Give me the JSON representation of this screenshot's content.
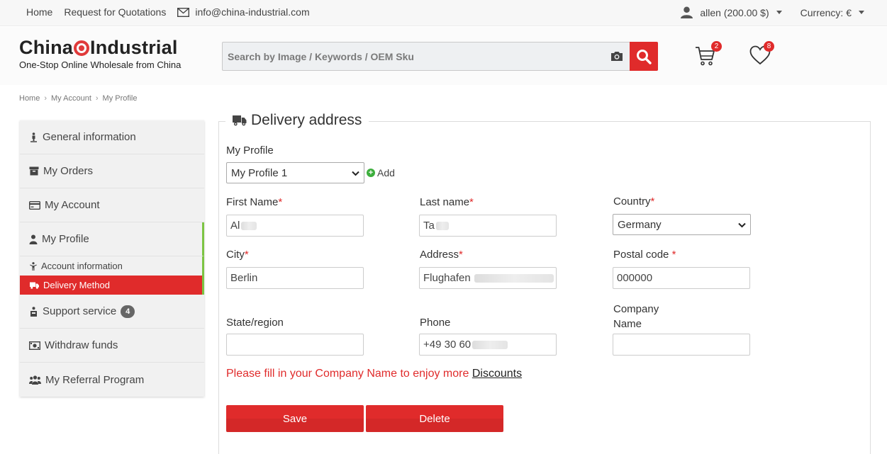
{
  "topbar": {
    "home": "Home",
    "quotations": "Request for Quotations",
    "email": "info@china-industrial.com",
    "user": "allen (200.00 $)",
    "currency": "Currency: €"
  },
  "header": {
    "logo_left": "China",
    "logo_right": "Industrial",
    "tagline": "One-Stop Online Wholesale from China",
    "search_placeholder": "Search by Image / Keywords / OEM Sku",
    "cart_count": "2",
    "wishlist_count": "8"
  },
  "breadcrumb": [
    "Home",
    "My Account",
    "My Profile"
  ],
  "sidebar": {
    "items": [
      {
        "label": "General information"
      },
      {
        "label": "My Orders"
      },
      {
        "label": "My Account"
      },
      {
        "label": "My Profile"
      }
    ],
    "sub_items": [
      {
        "label": "Account information"
      },
      {
        "label": "Delivery Method"
      }
    ],
    "items_after": [
      {
        "label": "Support service",
        "badge": "4"
      },
      {
        "label": "Withdraw funds"
      },
      {
        "label": "My Referral Program"
      }
    ]
  },
  "form": {
    "legend": "Delivery address",
    "profile_label": "My Profile",
    "profile_value": "My Profile 1",
    "add_label": "Add",
    "required_mark": "*",
    "first_name_label": "First Name",
    "first_name_value": "Al",
    "last_name_label": "Last name",
    "last_name_value": "Ta",
    "country_label": "Country",
    "country_value": "Germany",
    "city_label": "City",
    "city_value": "Berlin",
    "address_label": "Address",
    "address_value": "Flughafen",
    "postal_label": "Postal code",
    "postal_value": "000000",
    "state_label": "State/region",
    "state_value": "",
    "phone_label": "Phone",
    "phone_value": "+49 30 60",
    "company_label_1": "Company",
    "company_label_2": "Name",
    "company_value": "",
    "notice_text": "Please fill in your Company Name to enjoy more ",
    "notice_link": "Discounts",
    "save_label": "Save",
    "delete_label": "Delete"
  },
  "colors": {
    "accent": "#e02b2b",
    "active_bar": "#7cc443"
  }
}
